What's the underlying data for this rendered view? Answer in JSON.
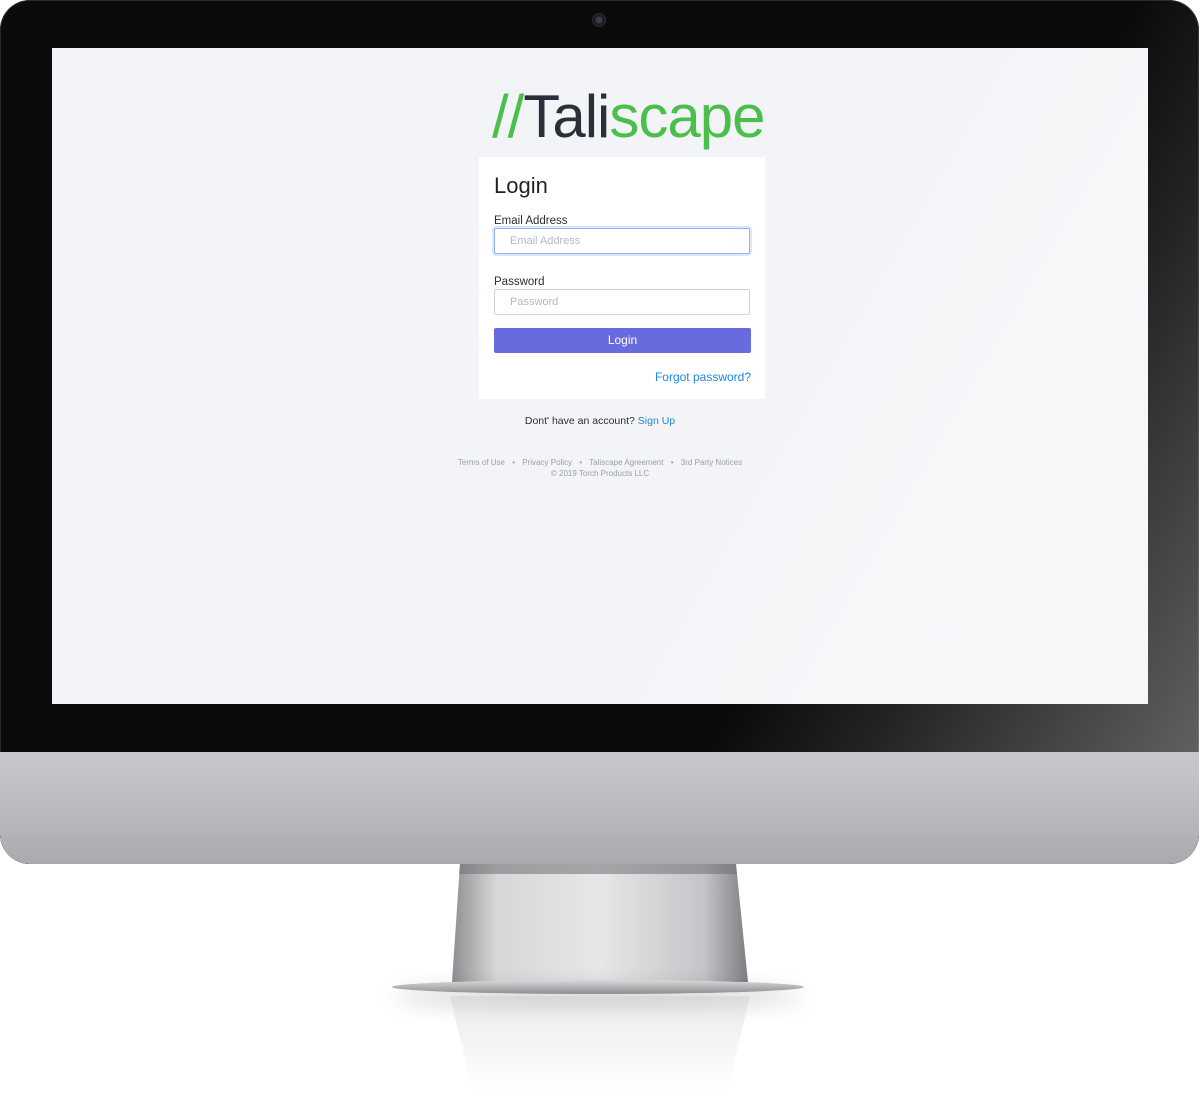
{
  "logo": {
    "slashes": "//",
    "part1": "Tali",
    "part2": "scape"
  },
  "login_card": {
    "title": "Login",
    "email_label": "Email Address",
    "email_placeholder": "Email Address",
    "email_value": "",
    "password_label": "Password",
    "password_placeholder": "Password",
    "password_value": "",
    "submit_label": "Login",
    "forgot_link": "Forgot password?"
  },
  "signup": {
    "prompt": "Dont' have an account?",
    "link": "Sign Up"
  },
  "footer": {
    "links": [
      "Terms of Use",
      "Privacy Policy",
      "Taliscape Agreement",
      "3rd Party Notices"
    ],
    "separator": "•",
    "copyright": "© 2019 Torch Products LLC"
  },
  "colors": {
    "brand_green": "#4bbf4b",
    "brand_dark": "#2b2f3a",
    "button": "#676bde",
    "link": "#1f87e0",
    "screen_bg": "#f2f4f7"
  }
}
